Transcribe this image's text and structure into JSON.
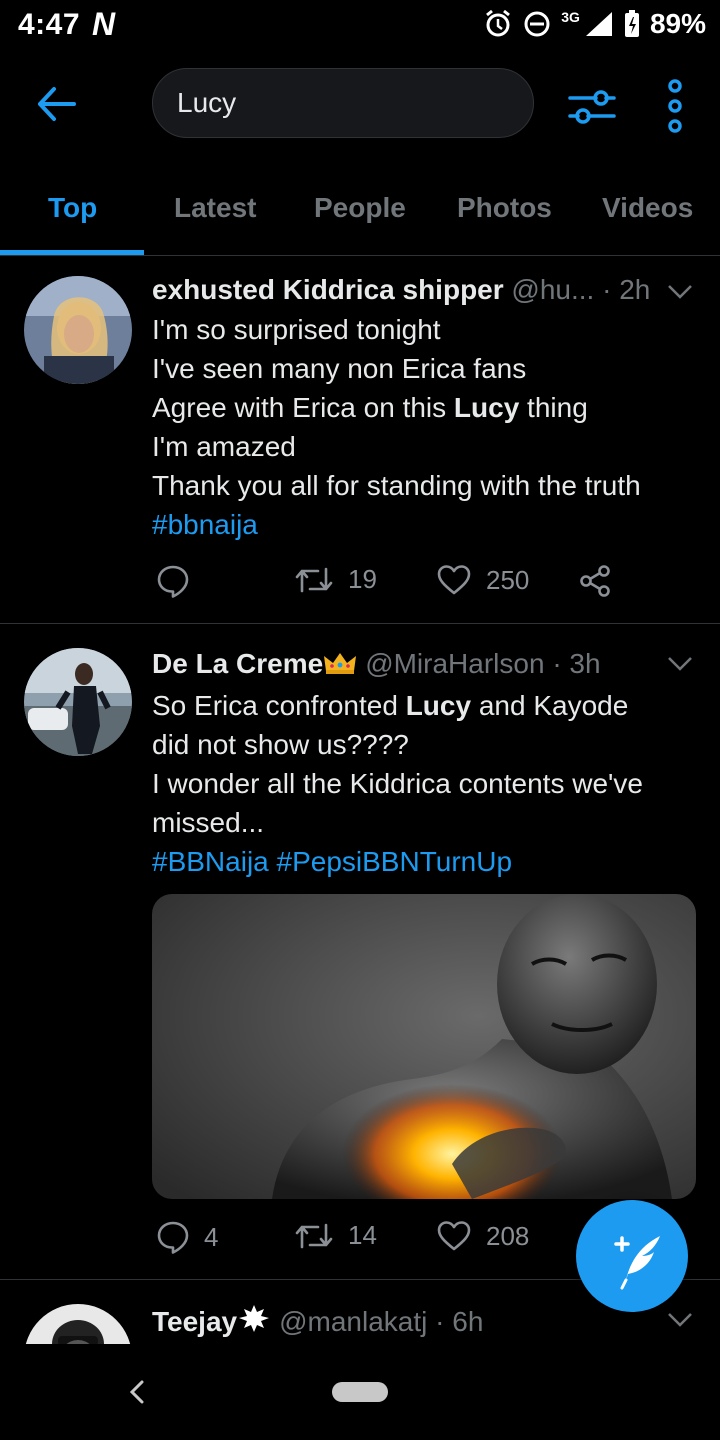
{
  "status_bar": {
    "time": "4:47",
    "notification_glyph": "N",
    "network": "3G",
    "battery": "89%",
    "icons": [
      "alarm-icon",
      "do-not-disturb-icon",
      "signal-icon",
      "battery-icon"
    ]
  },
  "search": {
    "query": "Lucy"
  },
  "tabs": [
    {
      "label": "Top",
      "active": true
    },
    {
      "label": "Latest",
      "active": false
    },
    {
      "label": "People",
      "active": false
    },
    {
      "label": "Photos",
      "active": false
    },
    {
      "label": "Videos",
      "active": false
    }
  ],
  "tweets": [
    {
      "name": "exhusted Kiddrica shipper",
      "handle": "@hu...",
      "time": "· 2h",
      "lines": {
        "l1": "I'm so surprised tonight",
        "l2": "I've seen many non Erica fans",
        "l3_pre": "Agree with Erica on this ",
        "l3_bold": "Lucy",
        "l3_post": " thing",
        "l4": "I'm amazed",
        "l5": "Thank you all for standing with the truth",
        "hashtags": "#bbnaija"
      },
      "replies": "",
      "retweets": "19",
      "likes": "250"
    },
    {
      "name": "De La Creme",
      "name_emoji": "crown-icon",
      "handle": "@MiraHarlson",
      "time": "· 3h",
      "lines": {
        "l1_pre": "So Erica confronted ",
        "l1_bold": "Lucy",
        "l1_post": " and Kayode",
        "l2": "did not show us????",
        "l3": "I wonder all the Kiddrica contents we've",
        "l4": "missed...",
        "hashtags": "#BBNaija #PepsiBBNTurnUp"
      },
      "replies": "4",
      "retweets": "14",
      "likes": "208"
    },
    {
      "name": "Teejay",
      "name_emoji": "sparkle-badge-icon",
      "handle": "@manlakatj",
      "time": "· 6h"
    }
  ],
  "colors": {
    "accent": "#1d9bf0",
    "background": "#000000",
    "muted": "#71767b"
  }
}
